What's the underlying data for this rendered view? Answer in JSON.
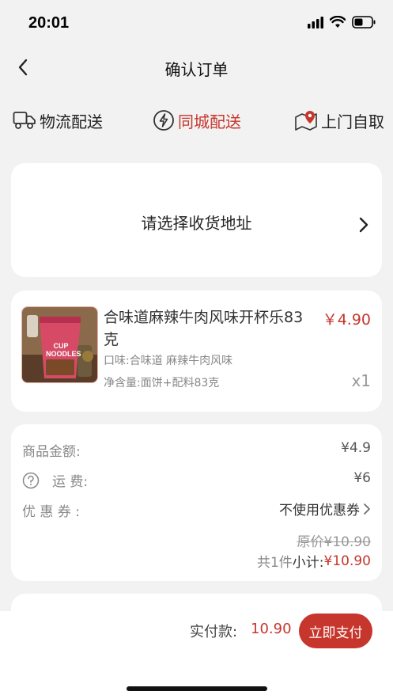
{
  "status_bar": {
    "time": "20:01"
  },
  "nav": {
    "title": "确认订单"
  },
  "tabs": [
    {
      "label": "物流配送",
      "icon": "truck-icon",
      "active": false
    },
    {
      "label": "同城配送",
      "icon": "lightning-icon",
      "active": true
    },
    {
      "label": "上门自取",
      "icon": "location-pin-icon",
      "active": false
    }
  ],
  "address": {
    "placeholder": "请选择收货地址"
  },
  "product": {
    "name": "合味道麻辣牛肉风味开杯乐83克",
    "price": "￥4.90",
    "spec": "口味:合味道 麻辣牛肉风味",
    "net": "净含量:面饼+配料83克",
    "qty": "x1",
    "image_text": "CUP NOODLES"
  },
  "summary": {
    "goods_label": "商品金额:",
    "goods_value": "¥4.9",
    "freight_label": "运 费:",
    "freight_value": "¥6",
    "coupon_label": "优 惠 券 :",
    "coupon_value": "不使用优惠券",
    "original_price": "原价¥10.90",
    "count_text": "共1件",
    "subtotal_label": "小计:",
    "subtotal_value": "¥10.90"
  },
  "footer": {
    "pay_label": "实付款:",
    "pay_amount": "10.90",
    "pay_button": "立即支付"
  },
  "colors": {
    "accent": "#c6362c",
    "background": "#f2f2f2"
  }
}
